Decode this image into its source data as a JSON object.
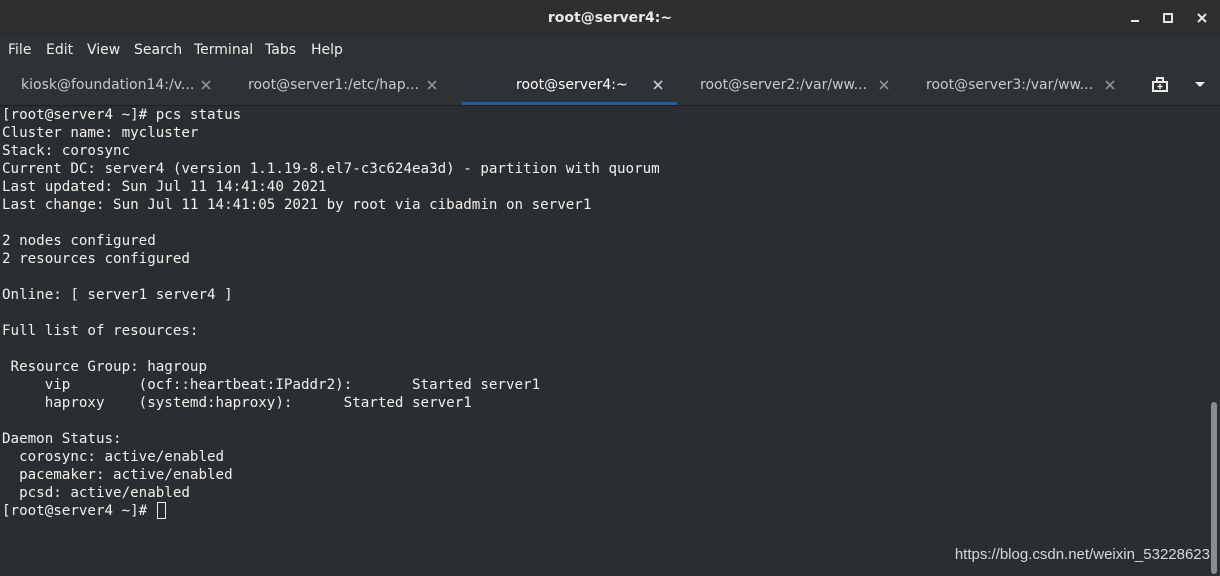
{
  "window": {
    "title": "root@server4:~",
    "minimize_icon": "minimize-icon",
    "maximize_icon": "maximize-icon",
    "close_icon": "close-icon"
  },
  "menu": [
    "File",
    "Edit",
    "View",
    "Search",
    "Terminal",
    "Tabs",
    "Help"
  ],
  "tabs": [
    {
      "label": "kiosk@foundation14:/v...",
      "active": false
    },
    {
      "label": "root@server1:/etc/hap...",
      "active": false
    },
    {
      "label": "root@server4:~",
      "active": true
    },
    {
      "label": "root@server2:/var/ww...",
      "active": false
    },
    {
      "label": "root@server3:/var/ww...",
      "active": false
    }
  ],
  "tab_tools": {
    "new_tab_icon": "new-tab-icon",
    "menu_icon": "chevron-down-icon"
  },
  "colors": {
    "accent": "#215d9c",
    "background": "#2b2e31",
    "text": "#f0f0ef"
  },
  "terminal": {
    "lines": [
      "[root@server4 ~]# pcs status",
      "Cluster name: mycluster",
      "Stack: corosync",
      "Current DC: server4 (version 1.1.19-8.el7-c3c624ea3d) - partition with quorum",
      "Last updated: Sun Jul 11 14:41:40 2021",
      "Last change: Sun Jul 11 14:41:05 2021 by root via cibadmin on server1",
      "",
      "2 nodes configured",
      "2 resources configured",
      "",
      "Online: [ server1 server4 ]",
      "",
      "Full list of resources:",
      "",
      " Resource Group: hagroup",
      "     vip        (ocf::heartbeat:IPaddr2):       Started server1",
      "     haproxy    (systemd:haproxy):      Started server1",
      "",
      "Daemon Status:",
      "  corosync: active/enabled",
      "  pacemaker: active/enabled",
      "  pcsd: active/enabled"
    ],
    "prompt": "[root@server4 ~]# "
  },
  "watermark": "https://blog.csdn.net/weixin_53228623"
}
